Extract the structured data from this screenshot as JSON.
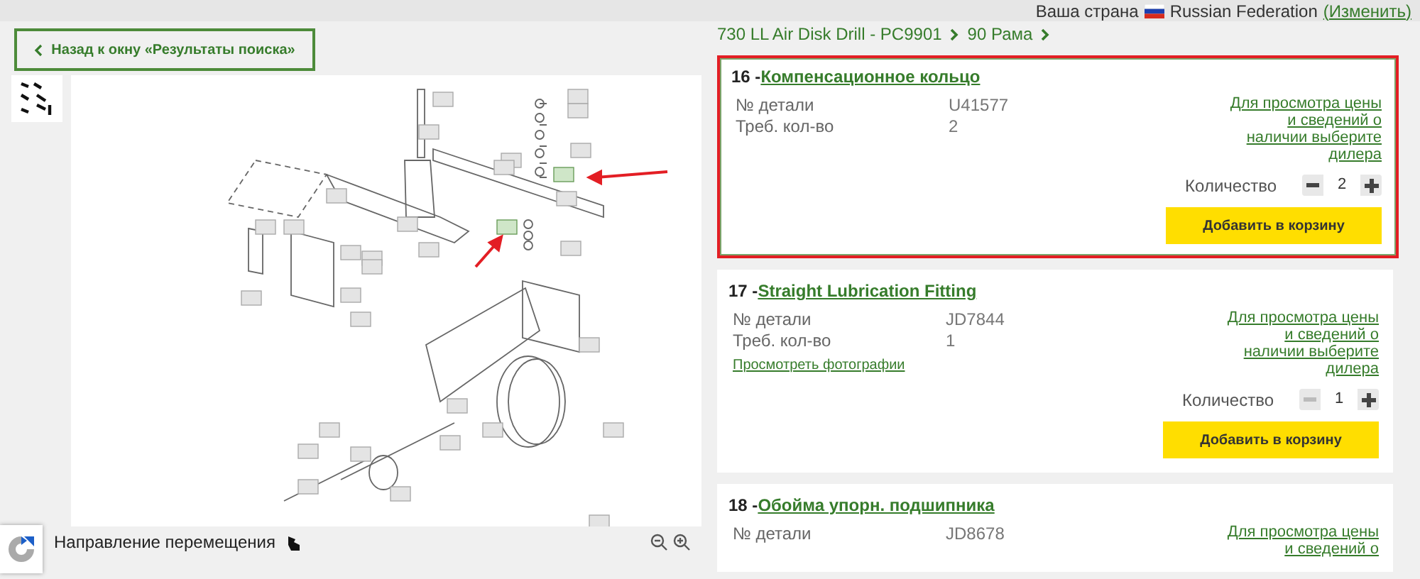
{
  "top_bar": {
    "country_label": "Ваша страна",
    "country": "Russian Federation",
    "change_link": "(Изменить)"
  },
  "back_button": {
    "label": "Назад к окну «Результаты поиска»"
  },
  "diagram": {
    "direction_label": "Направление перемещения"
  },
  "breadcrumb": [
    "730 LL Air Disk Drill - PC9901",
    "90 Рама"
  ],
  "parts": [
    {
      "number": "16 -",
      "title": "Компенсационное кольцо",
      "selected": true,
      "fields": [
        {
          "label": "№ детали",
          "value": "U41577"
        },
        {
          "label": "Треб. кол-во",
          "value": "2"
        }
      ],
      "dealer_link": "Для просмотра цены и сведений о наличии выберите дилера",
      "quantity_label": "Количество",
      "quantity": "2",
      "minus_disabled": false,
      "add_button": "Добавить в корзину"
    },
    {
      "number": "17 -",
      "title": "Straight Lubrication Fitting",
      "selected": false,
      "fields": [
        {
          "label": "№ детали",
          "value": "JD7844"
        },
        {
          "label": "Треб. кол-во",
          "value": "1"
        }
      ],
      "photos_link": "Просмотреть фотографии",
      "dealer_link": "Для просмотра цены и сведений о наличии выберите дилера",
      "quantity_label": "Количество",
      "quantity": "1",
      "minus_disabled": true,
      "add_button": "Добавить в корзину"
    },
    {
      "number": "18 -",
      "title": "Обойма упорн. подшипника",
      "selected": false,
      "fields": [
        {
          "label": "№ детали",
          "value": "JD8678"
        }
      ],
      "dealer_link": "Для просмотра цены и сведений о"
    }
  ]
}
